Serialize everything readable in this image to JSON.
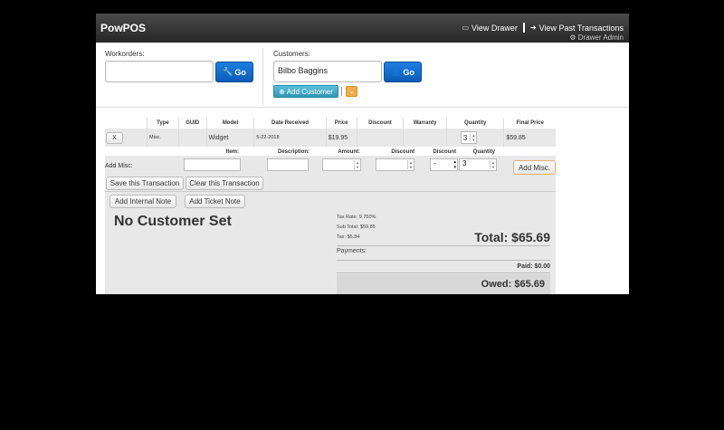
{
  "header": {
    "brand": "PowPOS",
    "view_drawer": "View Drawer",
    "view_past": "View Past Transactions",
    "drawer_admin": "Drawer Admin"
  },
  "workorders": {
    "label": "Workorders:",
    "value": "",
    "go": "Go"
  },
  "customers": {
    "label": "Customers:",
    "value": "Bilbo Baggins",
    "go": "Go",
    "add_customer": "Add Customer"
  },
  "table": {
    "headers": [
      "",
      "Type",
      "GUID",
      "Model",
      "Date Received",
      "Price",
      "Discount",
      "Warranty",
      "Quantity",
      "Final Price"
    ],
    "row": {
      "remove": "X",
      "type": "Misc.",
      "guid": "",
      "model": "Widget",
      "date": "5-22-2018",
      "price": "$19.95",
      "discount": "",
      "warranty": "",
      "quantity": "3",
      "final_price": "$59.85"
    }
  },
  "misc": {
    "label": "Add Misc:",
    "item_label": "Item:",
    "description_label": "Description:",
    "amount_label": "Amount:",
    "discount_label": "Discount",
    "discount2_label": "Discount",
    "quantity_label": "Quantity",
    "discount_select": "-",
    "quantity_value": "3",
    "add_button": "Add Misc."
  },
  "actions": {
    "save": "Save this Transaction",
    "clear": "Clear this Transaction",
    "internal_note": "Add Internal Note",
    "ticket_note": "Add Ticket Note"
  },
  "summary": {
    "customer": "No Customer Set",
    "tax_rate": "Tax Rate: 9.750%",
    "subtotal": "Sub Total: $59.85",
    "tax": "Tax: $5.84",
    "total": "Total: $65.69",
    "payments": "Payments:",
    "paid": "Paid: $0.00",
    "owed": "Owed: $65.69"
  },
  "colors": {
    "primary": "#0a5cb8",
    "info": "#2f96b4",
    "warning": "#f0ad4e"
  }
}
